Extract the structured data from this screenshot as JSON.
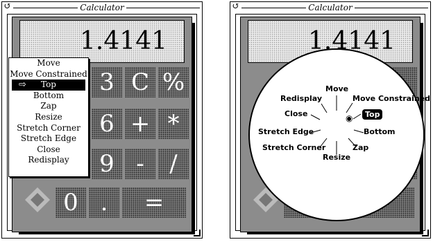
{
  "left_window": {
    "title": "Calculator",
    "display": "1.4141",
    "keys": [
      "3",
      "C",
      "%",
      "6",
      "+",
      "*",
      "9",
      "-",
      "/",
      "0",
      ".",
      "="
    ],
    "menu": {
      "items": [
        "Move",
        "Move Constrained",
        "Top",
        "Bottom",
        "Zap",
        "Resize",
        "Stretch Corner",
        "Stretch Edge",
        "Close",
        "Redisplay"
      ],
      "selected": "Top"
    }
  },
  "right_window": {
    "title": "Calculator",
    "display_partial": "1.4141",
    "pie_menu": {
      "items": [
        "Move",
        "Move Constrained",
        "Top",
        "Bottom",
        "Zap",
        "Resize",
        "Stretch Corner",
        "Stretch Edge",
        "Close",
        "Redisplay"
      ],
      "selected": "Top"
    }
  }
}
